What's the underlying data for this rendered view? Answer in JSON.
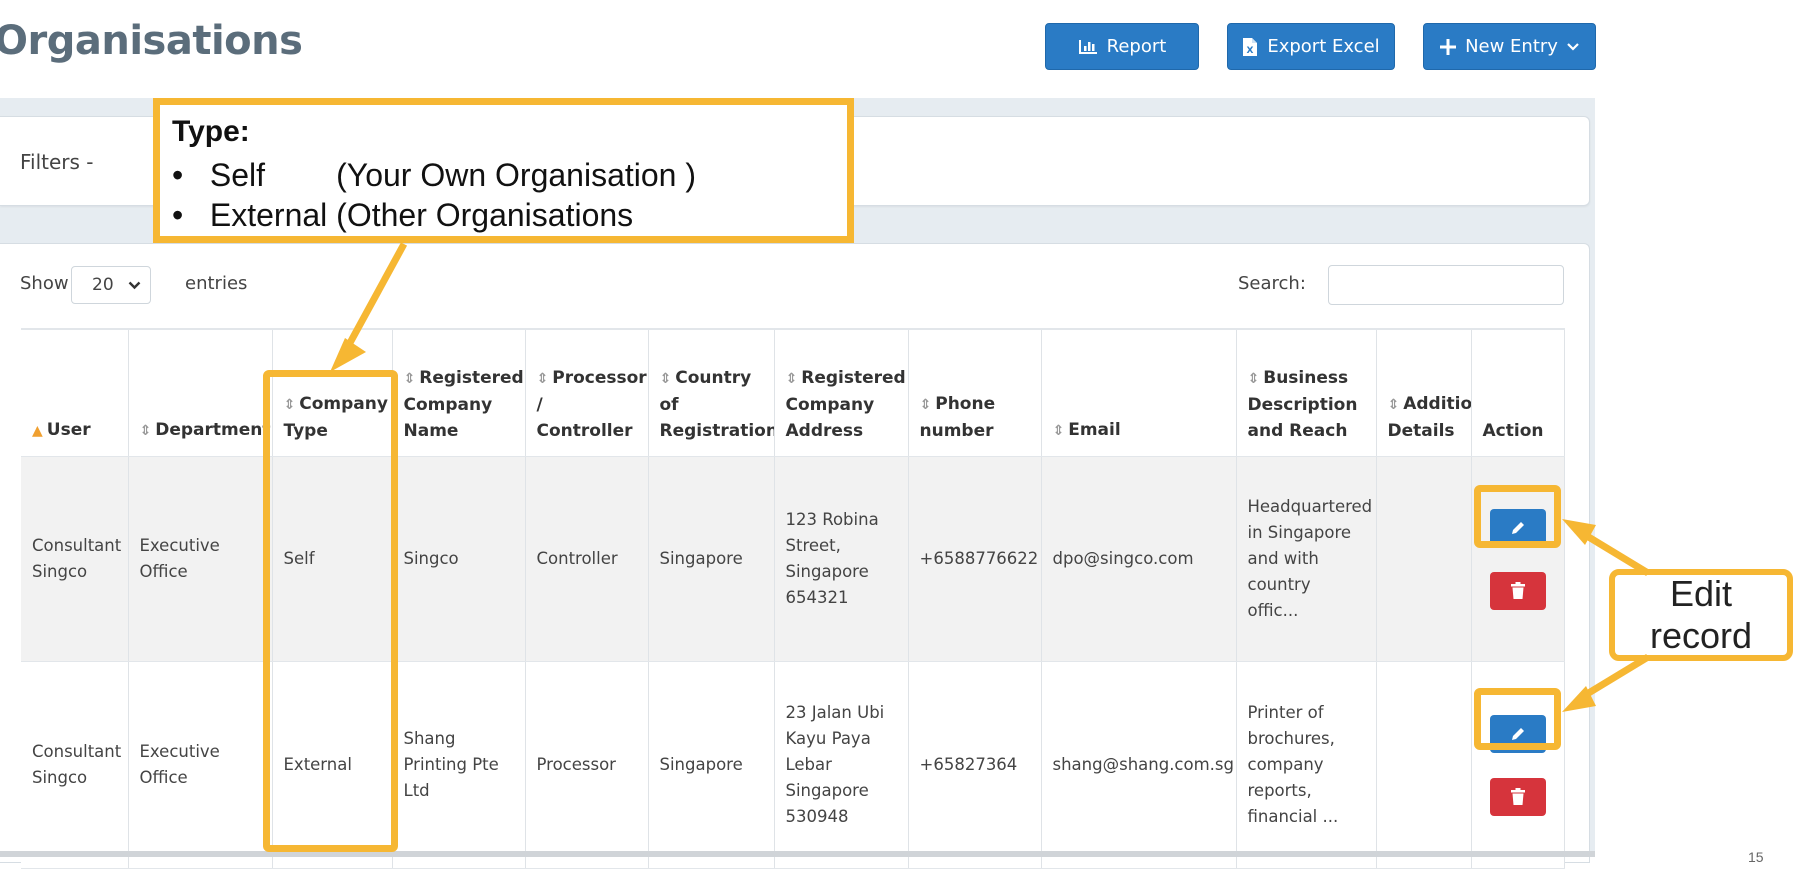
{
  "header": {
    "title": "Organisations",
    "buttons": {
      "report": "Report",
      "export_excel": "Export Excel",
      "new_entry": "New Entry"
    }
  },
  "filters": {
    "label": "Filters -"
  },
  "table_controls": {
    "show_label": "Show",
    "page_size": "20",
    "entries_label": "entries",
    "search_label": "Search:",
    "search_value": ""
  },
  "table": {
    "columns": [
      "User",
      "Department",
      "Company Type",
      "Registered Company Name",
      "Processor / Controller",
      "Country of Registration",
      "Registered Company Address",
      "Phone number",
      "Email",
      "Business Description and Reach",
      "Additional Details",
      "Action"
    ],
    "rows": [
      {
        "user": "Consultant Singco",
        "department": "Executive Office",
        "company_type": "Self",
        "company_name": "Singco",
        "role": "Controller",
        "country": "Singapore",
        "address": "123 Robina Street, Singapore 654321",
        "phone": "+6588776622",
        "email": "dpo@singco.com",
        "business": "Headquartered in Singapore and with country offic...",
        "details": ""
      },
      {
        "user": "Consultant Singco",
        "department": "Executive Office",
        "company_type": "External",
        "company_name": "Shang Printing Pte Ltd",
        "role": "Processor",
        "country": "Singapore",
        "address": "23 Jalan Ubi Kayu Paya Lebar Singapore 530948",
        "phone": "+65827364",
        "email": "shang@shang.com.sg",
        "business": "Printer of brochures, company reports, financial ...",
        "details": ""
      }
    ]
  },
  "annotations": {
    "type_title": "Type:",
    "type_line1": "•   Self        (Your Own Organisation )",
    "type_line2": "•   External (Other Organisations",
    "edit_label": "Edit record"
  },
  "footer": {
    "page_number": "15"
  },
  "colors": {
    "primary": "#2a7bc5",
    "danger": "#d6343c",
    "annotation": "#f6b733",
    "title": "#5b6d7b"
  }
}
